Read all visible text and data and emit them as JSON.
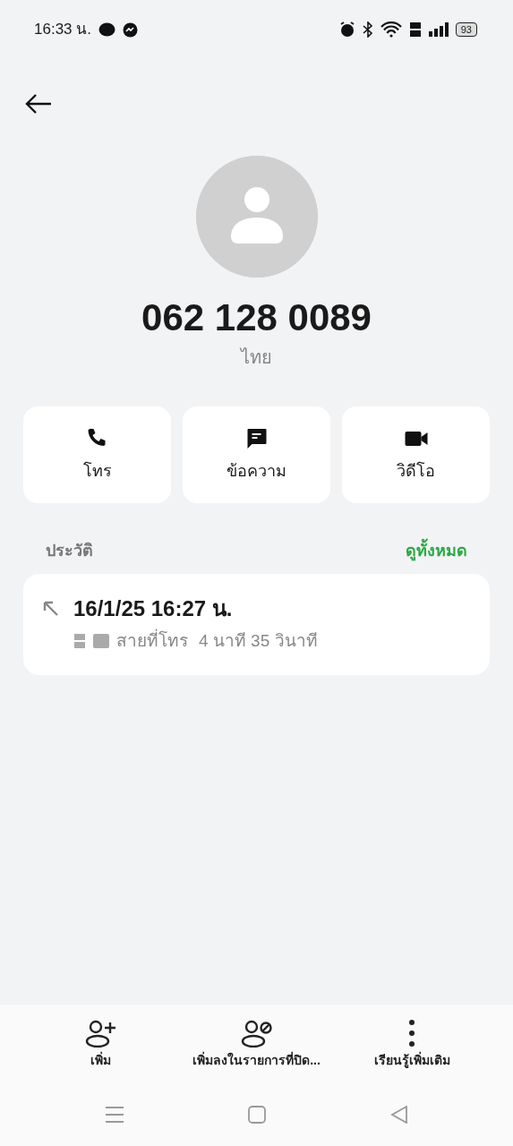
{
  "status_bar": {
    "time": "16:33 น.",
    "battery": "93"
  },
  "contact": {
    "number": "062 128 0089",
    "country": "ไทย"
  },
  "actions": [
    {
      "kind": "call",
      "label": "โทร"
    },
    {
      "kind": "message",
      "label": "ข้อความ"
    },
    {
      "kind": "video",
      "label": "วิดีโอ"
    }
  ],
  "history": {
    "title": "ประวัติ",
    "view_all": "ดูทั้งหมด",
    "entries": [
      {
        "datetime": "16/1/25 16:27 น.",
        "call_type": "สายที่โทร",
        "duration": "4 นาที 35 วินาที"
      }
    ]
  },
  "bottom_actions": [
    {
      "kind": "add",
      "label": "เพิ่ม"
    },
    {
      "kind": "block",
      "label": "เพิ่มลงในรายการที่ปิด..."
    },
    {
      "kind": "more",
      "label": "เรียนรู้เพิ่มเติม"
    }
  ]
}
